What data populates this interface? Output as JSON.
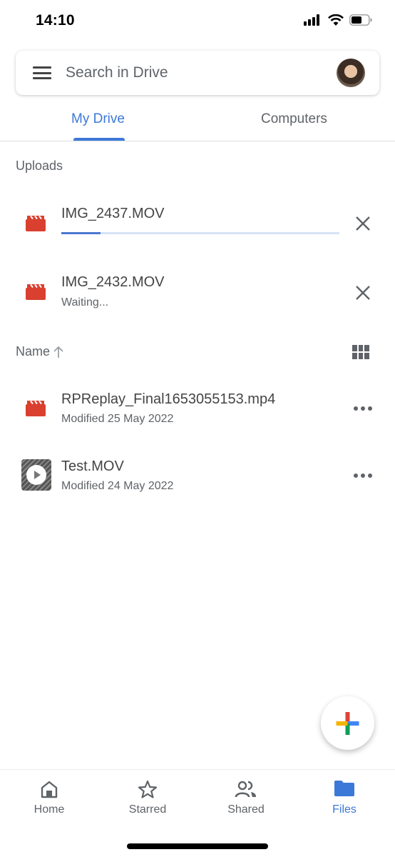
{
  "status_bar": {
    "time": "14:10",
    "icons": [
      "cellular-signal-icon",
      "wifi-icon",
      "battery-icon"
    ]
  },
  "search": {
    "placeholder": "Search in Drive",
    "menu_icon": "hamburger-menu-icon",
    "avatar": "user-avatar"
  },
  "tabs": [
    {
      "label": "My Drive",
      "active": true
    },
    {
      "label": "Computers",
      "active": false
    }
  ],
  "uploads": {
    "section_label": "Uploads",
    "items": [
      {
        "name": "IMG_2437.MOV",
        "status": "",
        "progress_percent": 14,
        "icon": "video-file-icon"
      },
      {
        "name": "IMG_2432.MOV",
        "status": "Waiting...",
        "icon": "video-file-icon"
      }
    ]
  },
  "sort": {
    "label": "Name",
    "direction": "ascending",
    "view_toggle": "grid-view-icon"
  },
  "files": [
    {
      "name": "RPReplay_Final1653055153.mp4",
      "modified": "Modified 25 May 2022",
      "icon": "video-file-icon"
    },
    {
      "name": "Test.MOV",
      "modified": "Modified 24 May 2022",
      "icon": "video-thumbnail"
    }
  ],
  "fab": {
    "icon": "plus-icon",
    "colors": {
      "top": "#db4437",
      "right": "#4285f4",
      "bottom": "#0f9d58",
      "left": "#f4b400"
    }
  },
  "bottom_nav": [
    {
      "label": "Home",
      "icon": "home-icon",
      "active": false
    },
    {
      "label": "Starred",
      "icon": "star-icon",
      "active": false
    },
    {
      "label": "Shared",
      "icon": "shared-people-icon",
      "active": false
    },
    {
      "label": "Files",
      "icon": "folder-icon",
      "active": true
    }
  ],
  "colors": {
    "accent": "#3c78d8",
    "video_icon": "#d9402f",
    "text_secondary": "#5f6368"
  }
}
